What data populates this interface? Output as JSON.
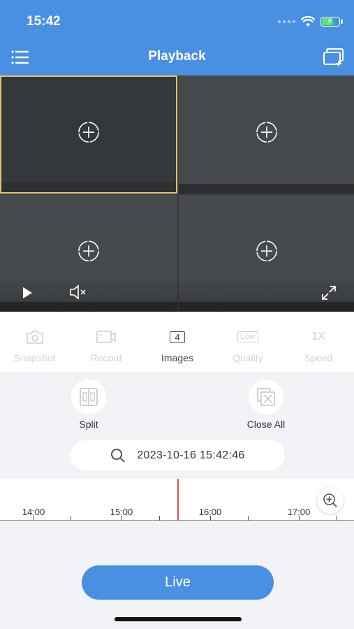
{
  "status_bar": {
    "time": "15:42"
  },
  "header": {
    "title": "Playback",
    "menu_icon": "hamburger-menu-icon",
    "add_icon": "add-window-icon"
  },
  "video_grid": {
    "cells": [
      {
        "selected": true
      },
      {
        "selected": false
      },
      {
        "selected": false
      },
      {
        "selected": false
      }
    ],
    "selected_border_color": "#e8c36a"
  },
  "toolbar": {
    "snapshot": "Snapshot",
    "record": "Record",
    "images": "Images",
    "images_count": "4",
    "quality": "Quality",
    "quality_value": "Low",
    "speed": "Speed",
    "speed_value": "1X"
  },
  "actions": {
    "split": "Split",
    "close_all": "Close All"
  },
  "search": {
    "datetime": "2023-10-16  15:42:46"
  },
  "timeline": {
    "labels": [
      "14:00",
      "15:00",
      "16:00",
      "17:00"
    ]
  },
  "live_button": "Live",
  "colors": {
    "accent": "#4a90e2",
    "cursor": "#e84a4a"
  }
}
